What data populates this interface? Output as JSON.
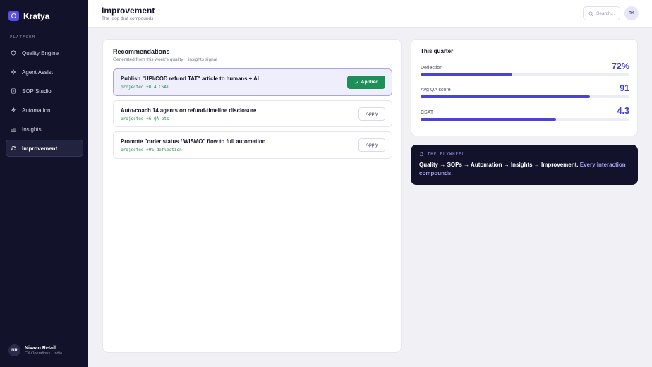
{
  "brand": {
    "name": "Kratya"
  },
  "sidebar": {
    "section_label": "PLATFORM",
    "items": [
      {
        "label": "Quality Engine",
        "icon": "shield-icon",
        "active": false
      },
      {
        "label": "Agent Assist",
        "icon": "sparkle-icon",
        "active": false
      },
      {
        "label": "SOP Studio",
        "icon": "document-icon",
        "active": false
      },
      {
        "label": "Automation",
        "icon": "bolt-icon",
        "active": false
      },
      {
        "label": "Insights",
        "icon": "bar-chart-icon",
        "active": false
      },
      {
        "label": "Improvement",
        "icon": "refresh-icon",
        "active": true
      }
    ],
    "user": {
      "initials": "NR",
      "name": "Nivaan Retail",
      "subtitle": "CX Operations · India"
    }
  },
  "header": {
    "title": "Improvement",
    "subtitle": "The loop that compounds",
    "search_placeholder": "Search...",
    "avatar_initials": "RK"
  },
  "recommendations": {
    "title": "Recommendations",
    "subtitle": "Generated from this week's quality + insights signal",
    "items": [
      {
        "title": "Publish \"UPI/COD refund TAT\" article to humans + AI",
        "projection": "projected +0.4 CSAT",
        "button": "Applied",
        "applied": true
      },
      {
        "title": "Auto-coach 14 agents on refund-timeline disclosure",
        "projection": "projected +6 QA pts",
        "button": "Apply",
        "applied": false
      },
      {
        "title": "Promote \"order status / WISMO\" flow to full automation",
        "projection": "projected +9% deflection",
        "button": "Apply",
        "applied": false
      }
    ]
  },
  "quarter": {
    "title": "This quarter",
    "metrics": [
      {
        "label": "Deflection",
        "value": "72%",
        "progress": 0.44
      },
      {
        "label": "Avg QA score",
        "value": "91",
        "progress": 0.81
      },
      {
        "label": "CSAT",
        "value": "4.3",
        "progress": 0.65
      }
    ]
  },
  "flywheel": {
    "label": "THE FLYWHEEL",
    "text": "Quality → SOPs → Automation → Insights → Improvement.",
    "highlight": "Every interaction compounds."
  },
  "colors": {
    "accent": "#4a43d6",
    "sidebar_bg": "#12132b",
    "applied_green": "#1f8f5a"
  }
}
